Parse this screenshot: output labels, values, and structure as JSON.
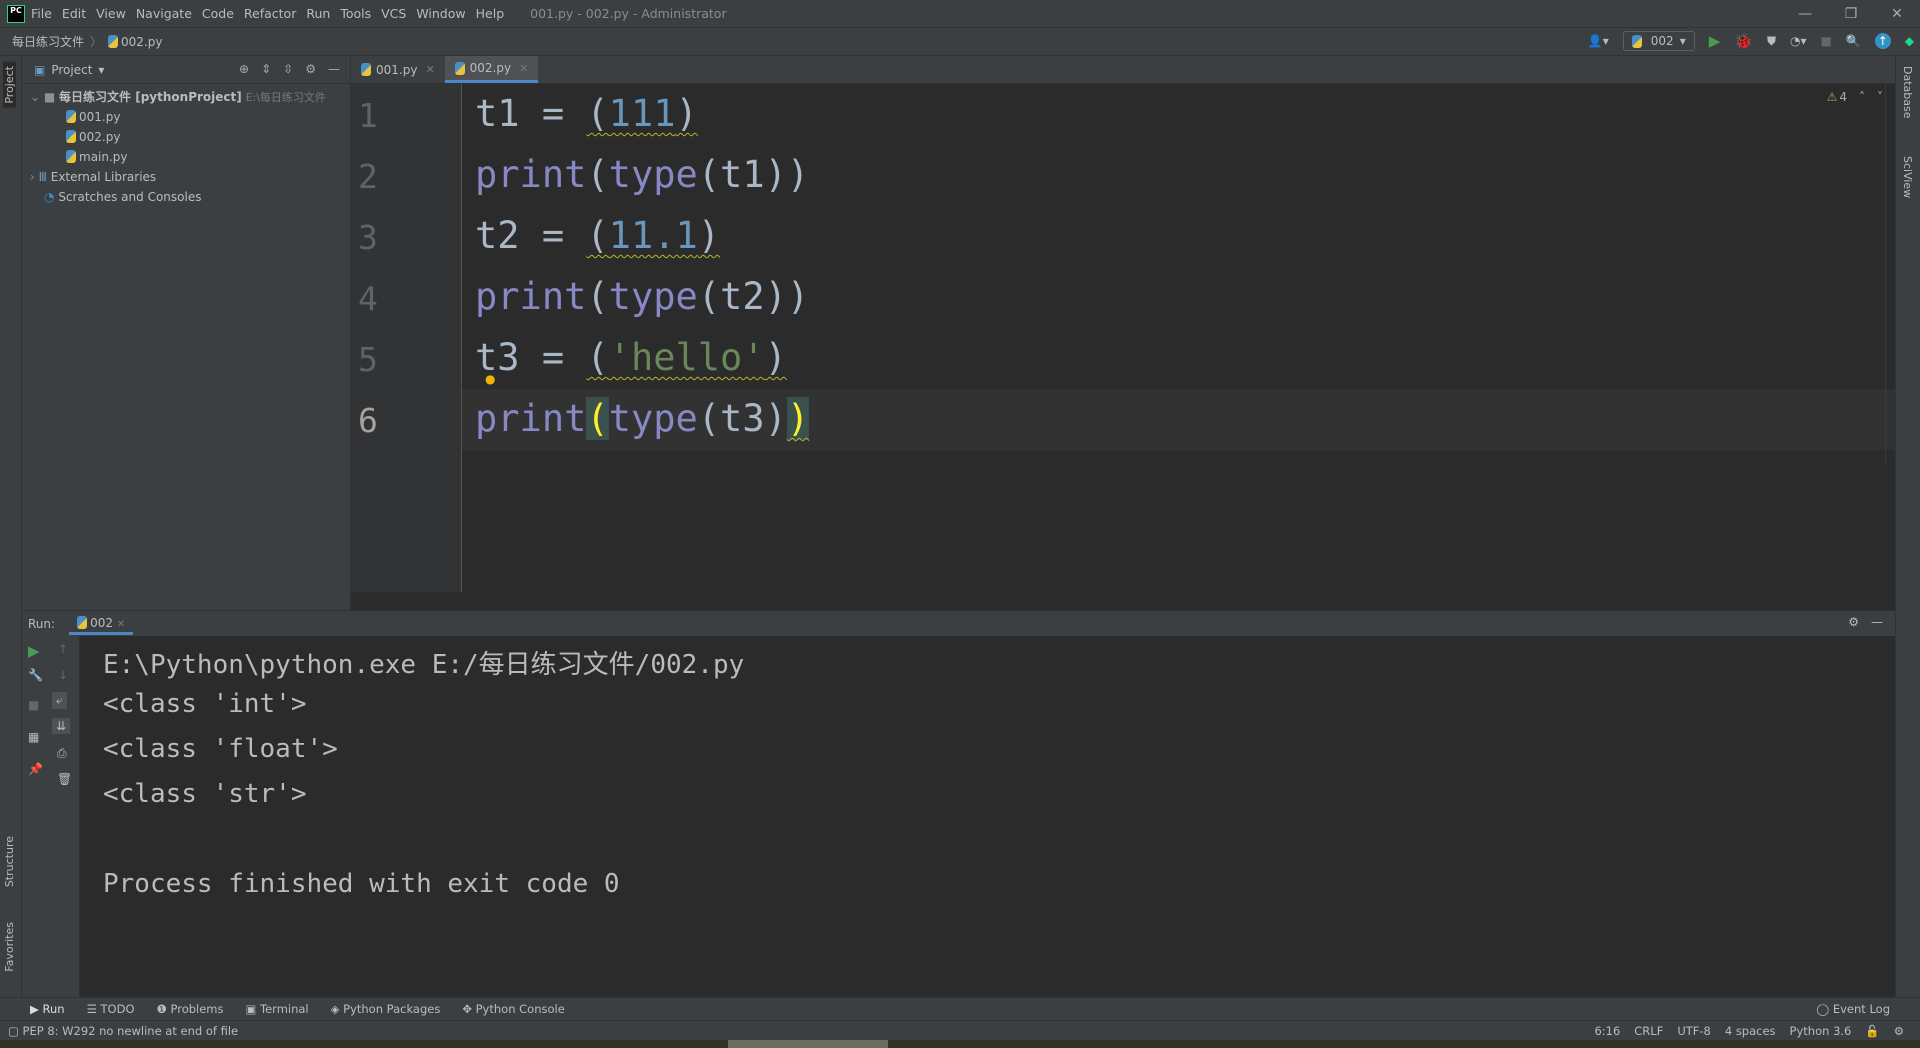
{
  "titlebar": {
    "logo": "PC",
    "menu": [
      "File",
      "Edit",
      "View",
      "Navigate",
      "Code",
      "Refactor",
      "Run",
      "Tools",
      "VCS",
      "Window",
      "Help"
    ],
    "title": "001.py - 002.py - Administrator"
  },
  "navbar": {
    "breadcrumb": [
      "每日练习文件",
      "002.py"
    ],
    "run_config": "002"
  },
  "left_stripe": {
    "project": "Project",
    "structure": "Structure",
    "favorites": "Favorites"
  },
  "right_stripe": {
    "database": "Database",
    "sciview": "SciView"
  },
  "project": {
    "title": "Project",
    "root": "每日练习文件 [pythonProject]",
    "root_path": "E:\\每日练习文件",
    "files": [
      "001.py",
      "002.py",
      "main.py"
    ],
    "external": "External Libraries",
    "scratches": "Scratches and Consoles"
  },
  "tabs": [
    {
      "label": "001.py",
      "active": false
    },
    {
      "label": "002.py",
      "active": true
    }
  ],
  "editor": {
    "warnings": "4",
    "line_numbers": [
      "1",
      "2",
      "3",
      "4",
      "5",
      "6"
    ],
    "current_line": 6
  },
  "run": {
    "label": "Run:",
    "tab": "002",
    "output": [
      "E:\\Python\\python.exe E:/每日练习文件/002.py",
      "<class 'int'>",
      "<class 'float'>",
      "<class 'str'>",
      "",
      "Process finished with exit code 0"
    ]
  },
  "toolwindows": [
    "Run",
    "TODO",
    "Problems",
    "Terminal",
    "Python Packages",
    "Python Console"
  ],
  "event_log": "Event Log",
  "status": {
    "message": "PEP 8: W292 no newline at end of file",
    "position": "6:16",
    "line_sep": "CRLF",
    "encoding": "UTF-8",
    "indent": "4 spaces",
    "interpreter": "Python 3.6"
  },
  "colors": {
    "accent": "#4a88c7",
    "run_green": "#499c54",
    "keyword": "#8888c6",
    "number": "#6897bb",
    "string": "#6a8759"
  }
}
